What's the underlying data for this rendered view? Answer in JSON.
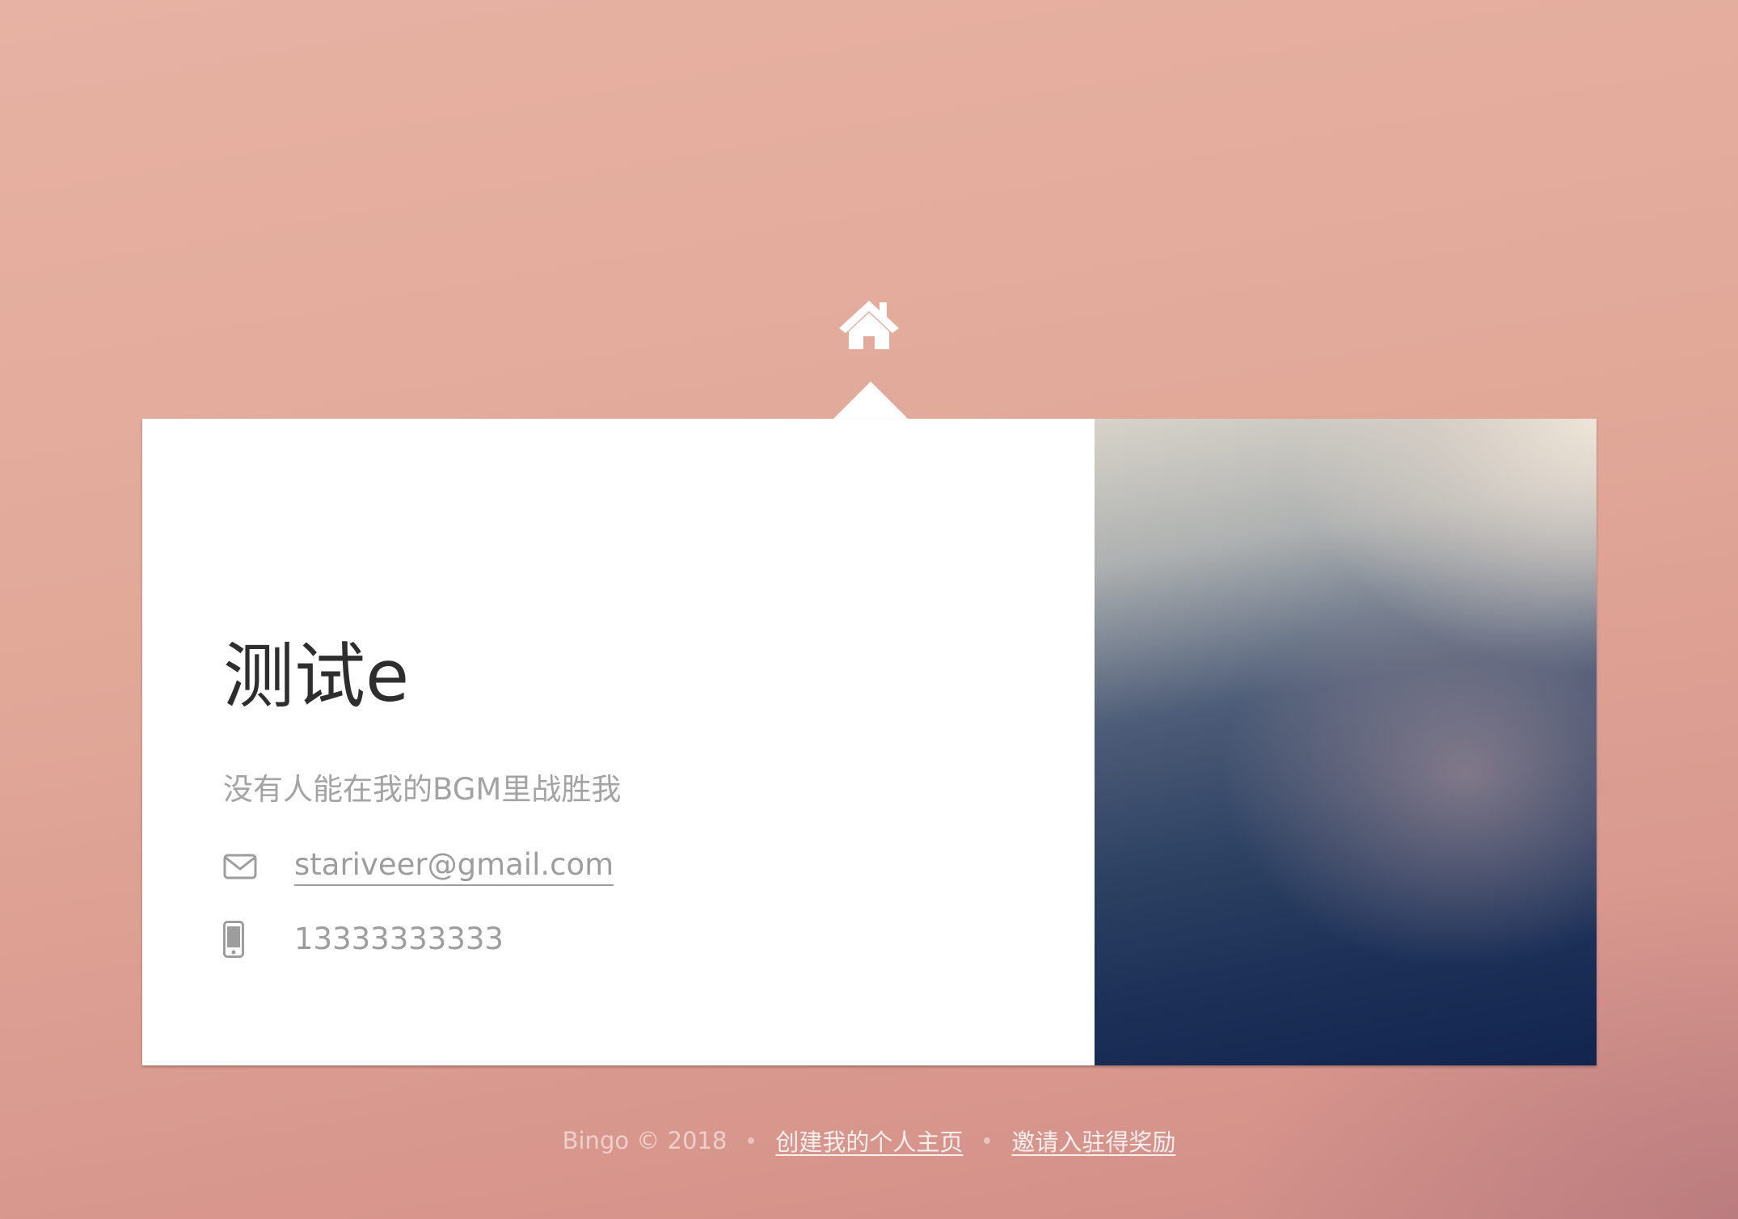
{
  "nav": {
    "home_icon": "home-icon"
  },
  "profile": {
    "name": "测试e",
    "tagline": "没有人能在我的BGM里战胜我",
    "email": "stariveer@gmail.com",
    "phone": "13333333333",
    "email_icon": "envelope-icon",
    "phone_icon": "mobile-phone-icon"
  },
  "footer": {
    "copyright": "Bingo © 2018",
    "create_link": "创建我的个人主页",
    "invite_link": "邀请入驻得奖励"
  },
  "colors": {
    "background": "#e1a898",
    "card": "#ffffff",
    "name_text": "#2e2e2e",
    "muted_text": "#a3a3a3",
    "image_dark": "#13254f",
    "image_light": "#e8e1d6"
  }
}
